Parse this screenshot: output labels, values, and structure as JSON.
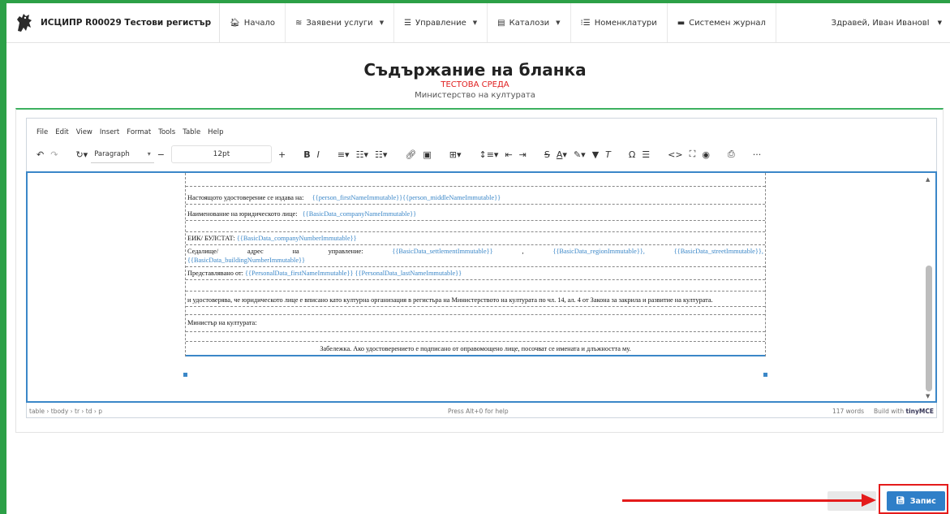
{
  "app": {
    "title": "ИСЦИПР R00029 Тестови регистър",
    "logo_icon": "lion-crest-icon"
  },
  "nav": {
    "items": [
      {
        "label": "Начало",
        "icon": "home-icon",
        "has_caret": false
      },
      {
        "label": "Заявени услуги",
        "icon": "stack-icon",
        "has_caret": true
      },
      {
        "label": "Управление",
        "icon": "sliders-icon",
        "has_caret": true
      },
      {
        "label": "Каталози",
        "icon": "catalog-icon",
        "has_caret": true
      },
      {
        "label": "Номенклатури",
        "icon": "list-icon",
        "has_caret": false
      },
      {
        "label": "Системен журнал",
        "icon": "journal-icon",
        "has_caret": false
      }
    ],
    "user_label": "Здравей, Иван ИвановІ"
  },
  "page": {
    "title": "Съдържание на бланка",
    "environment": "ТЕСТОВА СРЕДА",
    "ministry": "Министерство на културата"
  },
  "editor": {
    "menu": [
      "File",
      "Edit",
      "View",
      "Insert",
      "Format",
      "Tools",
      "Table",
      "Help"
    ],
    "block_format": "Paragraph",
    "font_size": "12pt",
    "status_path": "table › tbody › tr › td › p",
    "status_help": "Press Alt+0 for help",
    "word_count": "117 words",
    "build_with": "Build with",
    "brand": "tinyMCE"
  },
  "document": {
    "row_issued": {
      "text": "Настоящото удостоверение се издава на:",
      "ph1": "{{person_firstNameImmutable}}",
      "ph2": "{{person_middleNameImmutable}}"
    },
    "row_company": {
      "text": "Наименование на юридическото лице:",
      "ph": "{{BasicData_companyNameImmutable}}"
    },
    "row_eik": {
      "text": "ЕИК/ БУЛСТАТ:",
      "ph": "{{BasicData_companyNumberImmutable}}"
    },
    "row_address": {
      "w1": "Седалище/",
      "w2": "адрес",
      "w3": "на",
      "w4": "управление:",
      "ph1": "{{BasicData_settlementImmutable}}",
      "comma": ",",
      "ph2": "{{BasicData_regionImmutable}},",
      "ph3": "{{BasicData_streetImmutable}},",
      "ph4": "{{BasicData_buildingNumberImmutable}}"
    },
    "row_represented": {
      "text": "Представлявано от:",
      "ph1": "{{PersonalData_firstNameImmutable}}",
      "ph2": "{{PersonalData_lastNameImmutable}}"
    },
    "row_certifies": "и удостоверява, че юридическото лице е вписано като културна организация в регистъра на Министерството на културата по чл. 14, ал. 4 от Закона за закрила и развитие на културата.",
    "row_minister": "Министър на културата:",
    "row_note": "Забележка. Ако удостоверението е подписано от оправомощено лице, посочват се имената и длъжността му."
  },
  "actions": {
    "cancel_label": "",
    "save_label": "Запис"
  },
  "colors": {
    "accent_green": "#2ca047",
    "primary_blue": "#2f7fc8",
    "environment_red": "#e02020",
    "annotation_red": "#e41b1b"
  }
}
